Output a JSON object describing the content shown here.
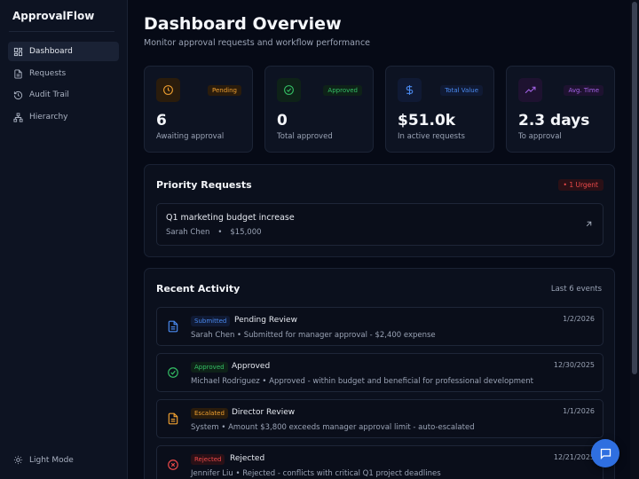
{
  "app": {
    "name": "ApprovalFlow"
  },
  "sidebar": {
    "items": [
      {
        "label": "Dashboard",
        "icon": "dashboard-grid-icon",
        "active": true
      },
      {
        "label": "Requests",
        "icon": "document-icon",
        "active": false
      },
      {
        "label": "Audit Trail",
        "icon": "history-icon",
        "active": false
      },
      {
        "label": "Hierarchy",
        "icon": "org-chart-icon",
        "active": false
      }
    ],
    "theme_toggle": "Light Mode"
  },
  "header": {
    "title": "Dashboard Overview",
    "subtitle": "Monitor approval requests and workflow performance"
  },
  "stats": [
    {
      "badge": "Pending",
      "value": "6",
      "label": "Awaiting approval",
      "icon": "clock-icon",
      "color": "#f0a030"
    },
    {
      "badge": "Approved",
      "value": "0",
      "label": "Total approved",
      "icon": "check-circle-icon",
      "color": "#34c065"
    },
    {
      "badge": "Total Value",
      "value": "$51.0k",
      "label": "In active requests",
      "icon": "dollar-icon",
      "color": "#4a8af0"
    },
    {
      "badge": "Avg. Time",
      "value": "2.3 days",
      "label": "To approval",
      "icon": "trending-up-icon",
      "color": "#a463e8"
    }
  ],
  "priority": {
    "title": "Priority Requests",
    "badge": "• 1 Urgent",
    "items": [
      {
        "title": "Q1 marketing budget increase",
        "requester": "Sarah Chen",
        "separator": "•",
        "amount": "$15,000"
      }
    ]
  },
  "activity": {
    "title": "Recent Activity",
    "count_label": "Last 6 events",
    "items": [
      {
        "badge": "Submitted",
        "title": "Pending Review",
        "desc": "Sarah Chen • Submitted for manager approval - $2,400 expense",
        "date": "1/2/2026",
        "icon": "file-icon",
        "color": "#4a8af0"
      },
      {
        "badge": "Approved",
        "title": "Approved",
        "desc": "Michael Rodriguez • Approved - within budget and beneficial for professional development",
        "date": "12/30/2025",
        "icon": "check-circle-icon",
        "color": "#34c065"
      },
      {
        "badge": "Escalated",
        "title": "Director Review",
        "desc": "System • Amount $3,800 exceeds manager approval limit - auto-escalated",
        "date": "1/1/2026",
        "icon": "file-icon",
        "color": "#f0a030"
      },
      {
        "badge": "Rejected",
        "title": "Rejected",
        "desc": "Jennifer Liu • Rejected - conflicts with critical Q1 project deadlines",
        "date": "12/21/2025",
        "icon": "x-circle-icon",
        "color": "#ef4a4a"
      }
    ]
  },
  "chat": {
    "icon": "chat-icon"
  }
}
